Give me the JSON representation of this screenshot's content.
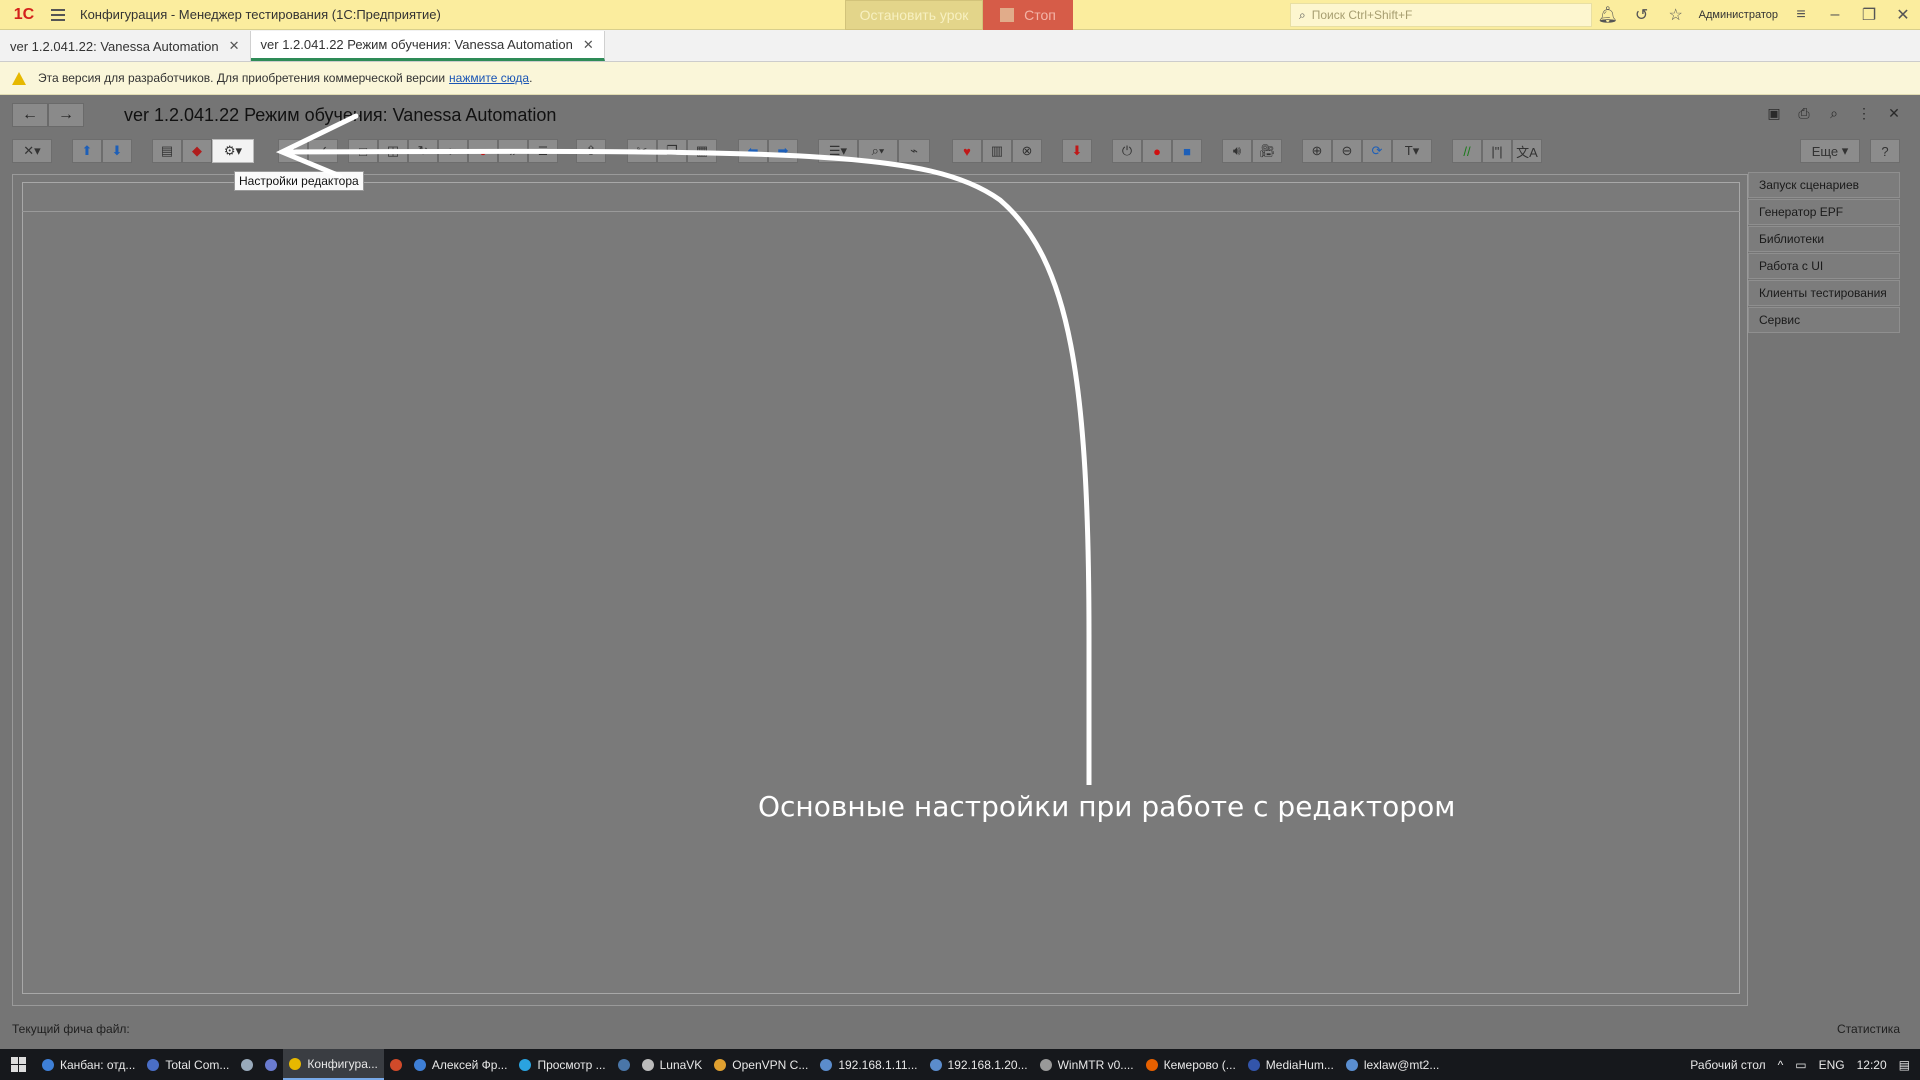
{
  "titlebar": {
    "logo": "1C",
    "title": "Конфигурация  - Менеджер тестирования (1С:Предприятие)",
    "stop_lesson": "Остановить урок",
    "stol": "Стоп",
    "search_placeholder": "Поиск Ctrl+Shift+F",
    "user": "Администратор"
  },
  "tabs": [
    {
      "label": "ver 1.2.041.22: Vanessa Automation",
      "active": false
    },
    {
      "label": "ver 1.2.041.22 Режим обучения: Vanessa Automation",
      "active": true
    }
  ],
  "warning": {
    "text": "Эта версия для разработчиков. Для приобретения коммерческой версии",
    "link": "нажмите сюда",
    "end": "."
  },
  "form": {
    "title": "ver 1.2.041.22 Режим обучения: Vanessa Automation",
    "more_button": "Еще",
    "help_button": "?",
    "tooltip": "Настройки редактора"
  },
  "side_panel": {
    "items": [
      "Запуск сценариев",
      "Генератор EPF",
      "Библиотеки",
      "Работа с UI",
      "Клиенты тестирования",
      "Сервис"
    ]
  },
  "footer": {
    "current_feature": "Текущий фича файл:",
    "statistics": "Статистика"
  },
  "annotation": "Основные настройки при работе с редактором",
  "taskbar": {
    "items": [
      "Канбан: отд...",
      "Total Com...",
      "",
      "",
      "Конфигура...",
      "",
      "Алексей Фр...",
      "Просмотр ...",
      "",
      "LunaVK",
      "OpenVPN C...",
      "192.168.1.11...",
      "192.168.1.20...",
      "WinMTR v0....",
      "Кемерово (...",
      "MediaHum...",
      "lexlaw@mt2..."
    ],
    "desktop": "Рабочий стол",
    "lang": "ENG",
    "time": "12:20"
  },
  "colors": {
    "titlebar": "#fbed9e",
    "content_overlay": "#757575",
    "active_tab_underline": "#2e8b57",
    "link": "#1a55b5"
  }
}
